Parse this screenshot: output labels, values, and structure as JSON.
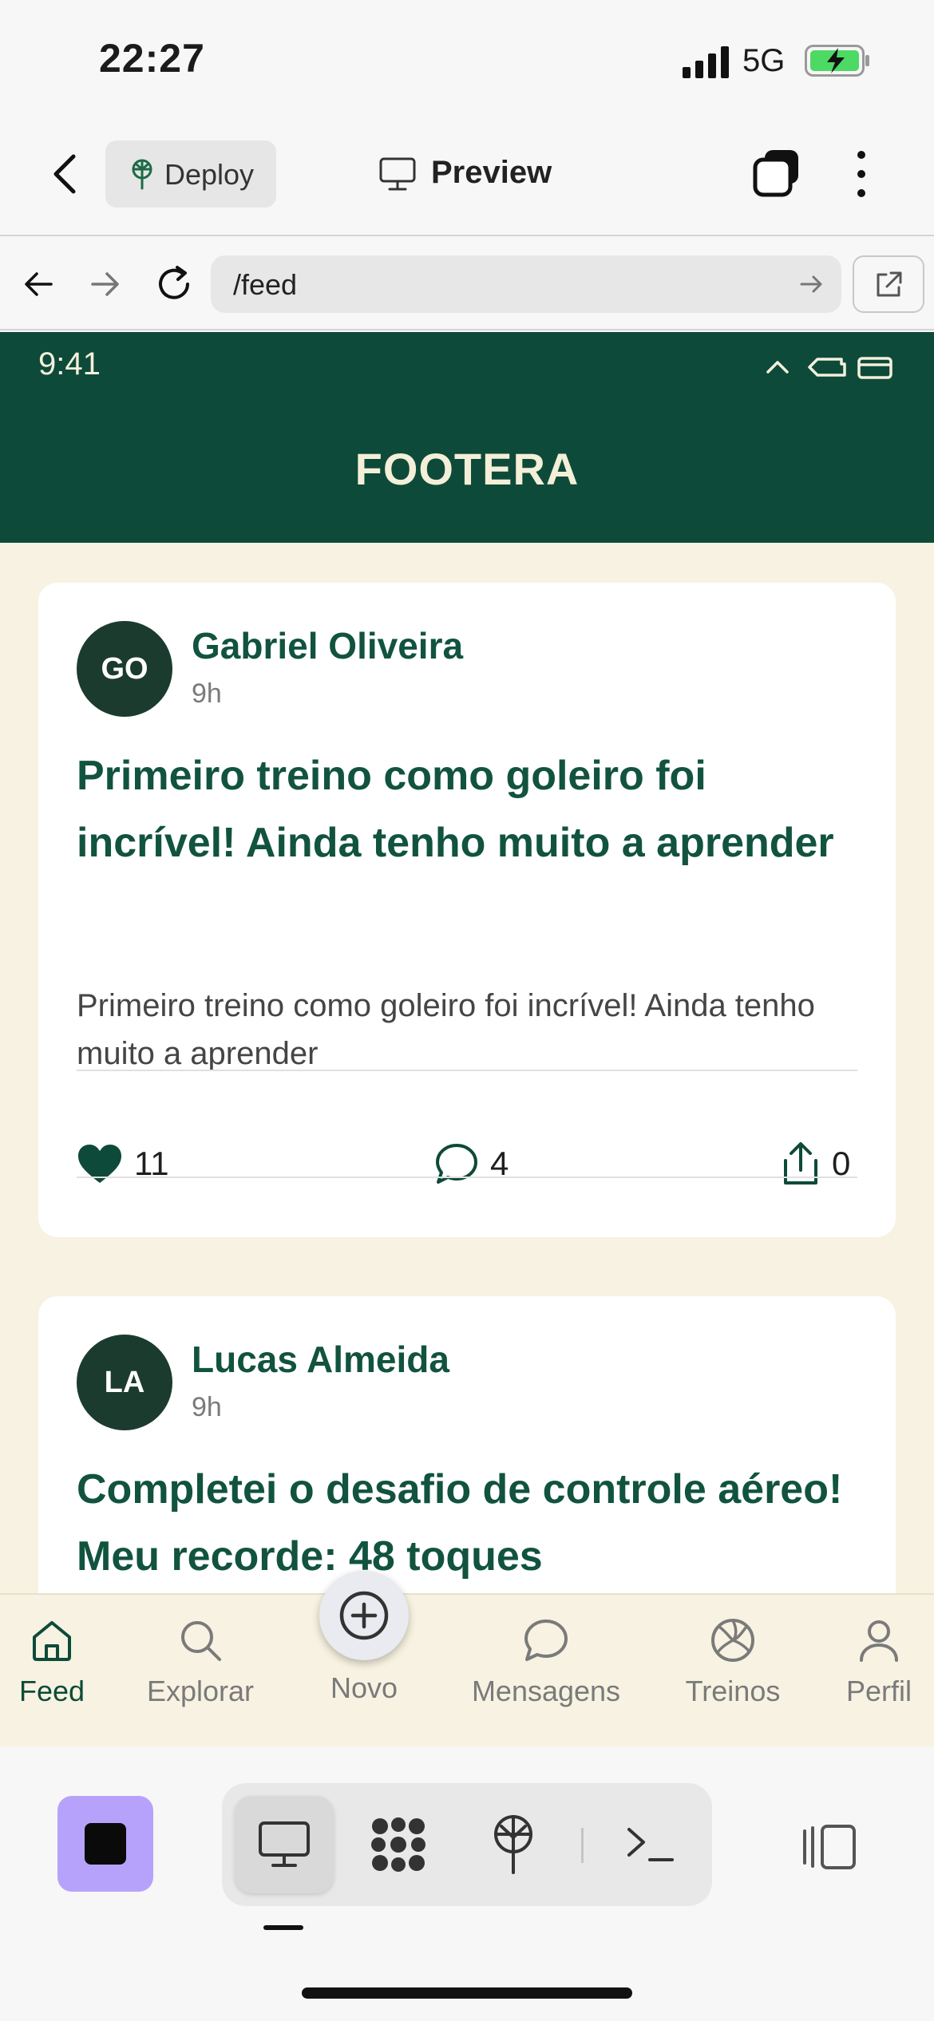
{
  "ios_status": {
    "time": "22:27",
    "network": "5G"
  },
  "toolbar": {
    "deploy_label": "Deploy",
    "preview_label": "Preview"
  },
  "browser": {
    "url": "/feed"
  },
  "app": {
    "status_time": "9:41",
    "title": "FOOTERA"
  },
  "posts": [
    {
      "initials": "GO",
      "author": "Gabriel Oliveira",
      "ago": "9h",
      "title": "Primeiro treino como goleiro foi incrível! Ainda tenho muito a aprender",
      "body": "Primeiro treino como goleiro foi incrível! Ainda tenho muito a aprender",
      "likes": "11",
      "comments": "4",
      "shares": "0"
    },
    {
      "initials": "LA",
      "author": "Lucas Almeida",
      "ago": "9h",
      "title": "Completei o desafio de controle aéreo! Meu recorde: 48 toques"
    }
  ],
  "tabs": [
    {
      "label": "Feed",
      "icon": "home-icon",
      "active": true
    },
    {
      "label": "Explorar",
      "icon": "search-icon"
    },
    {
      "label": "Novo",
      "icon": "plus-circle-icon"
    },
    {
      "label": "Mensagens",
      "icon": "chat-icon"
    },
    {
      "label": "Treinos",
      "icon": "volleyball-icon"
    },
    {
      "label": "Perfil",
      "icon": "user-icon"
    }
  ],
  "colors": {
    "brand_green": "#0e4a39",
    "cream": "#f7f2e1",
    "stop_button": "#b7a2fb"
  }
}
